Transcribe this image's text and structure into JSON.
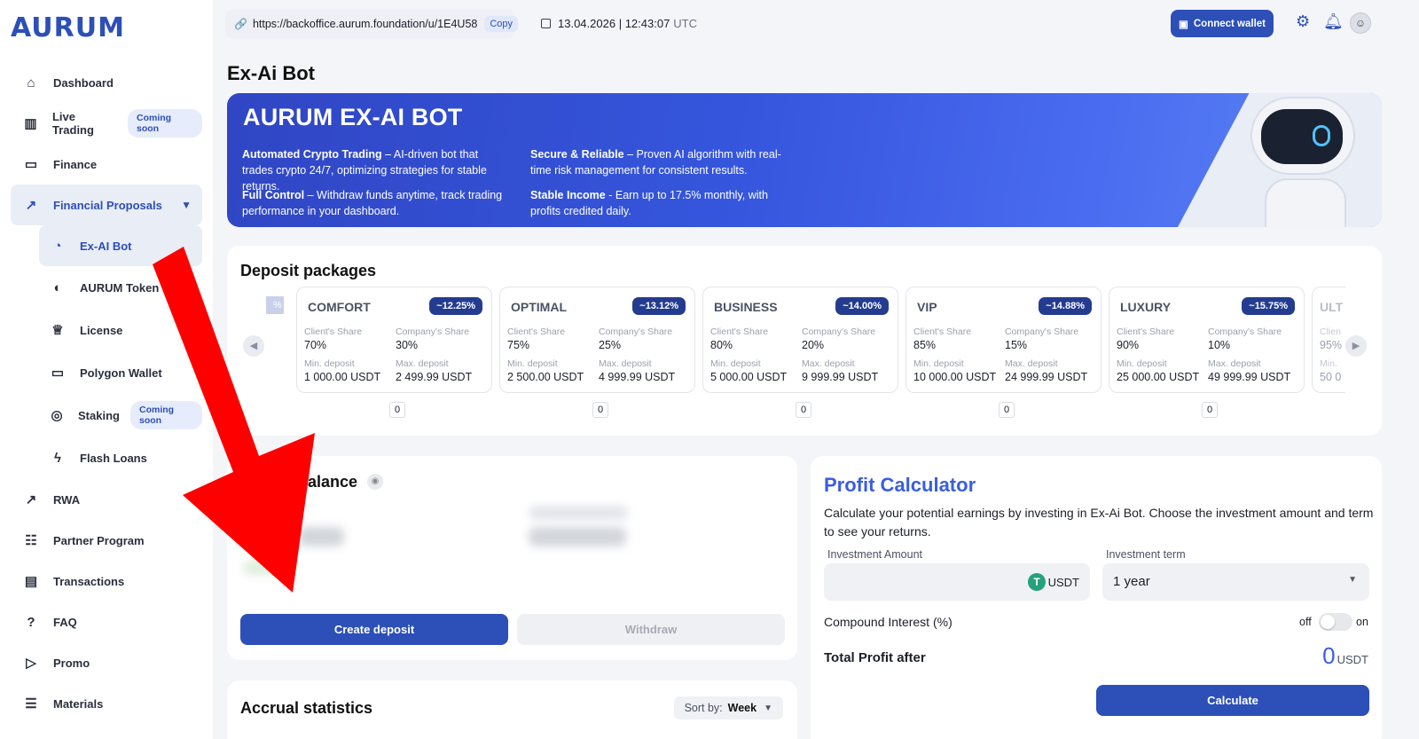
{
  "app": {
    "logo": "AURUM"
  },
  "topbar": {
    "url": "https://backoffice.aurum.foundation/u/1E4U58",
    "copy_label": "Copy",
    "date": "13.04.2026",
    "time": "| 12:43:07",
    "timezone": "UTC",
    "connect_wallet_label": "Connect wallet"
  },
  "sidebar": {
    "items": [
      {
        "label": "Dashboard",
        "icon": "home-icon"
      },
      {
        "label": "Live Trading",
        "icon": "bar-chart-icon",
        "badge": "Coming soon"
      },
      {
        "label": "Finance",
        "icon": "wallet-icon"
      },
      {
        "label": "Financial Proposals",
        "icon": "trend-icon",
        "expanded": true
      },
      {
        "label": "Ex-AI Bot",
        "icon": "pie-icon",
        "active": true
      },
      {
        "label": "AURUM Token",
        "icon": "token-icon"
      },
      {
        "label": "License",
        "icon": "crown-icon"
      },
      {
        "label": "Polygon Wallet",
        "icon": "wallet-icon"
      },
      {
        "label": "Staking",
        "icon": "staking-icon",
        "badge": "Coming soon"
      },
      {
        "label": "Flash Loans",
        "icon": "lightning-icon"
      },
      {
        "label": "RWA",
        "icon": "trend-up-icon"
      },
      {
        "label": "Partner Program",
        "icon": "users-icon"
      },
      {
        "label": "Transactions",
        "icon": "document-icon"
      },
      {
        "label": "FAQ",
        "icon": "question-icon"
      },
      {
        "label": "Promo",
        "icon": "promo-icon"
      },
      {
        "label": "Materials",
        "icon": "materials-icon"
      }
    ]
  },
  "page": {
    "title": "Ex-Ai Bot"
  },
  "banner": {
    "title": "AURUM EX-AI BOT",
    "features": [
      {
        "title": "Automated Crypto Trading",
        "text": " – AI-driven bot that trades crypto 24/7, optimizing strategies for stable returns."
      },
      {
        "title": "Full Control",
        "text": " – Withdraw funds anytime, track trading performance in your dashboard."
      },
      {
        "title": "Secure & Reliable",
        "text": " – Proven AI algorithm with real-time risk management for consistent results."
      },
      {
        "title": "Stable Income",
        "text": " - Earn up to 17.5% monthly, with profits credited daily."
      }
    ]
  },
  "deposit_packages": {
    "title": "Deposit packages",
    "labels": {
      "client_share": "Client's Share",
      "company_share": "Company's Share",
      "min_deposit": "Min. deposit",
      "max_deposit": "Max. deposit"
    },
    "packages": [
      {
        "name": "COMFORT",
        "pct": "~12.25%",
        "client": "70%",
        "company": "30%",
        "min": "1 000.00 USDT",
        "max": "2 499.99 USDT",
        "qty": "0"
      },
      {
        "name": "OPTIMAL",
        "pct": "~13.12%",
        "client": "75%",
        "company": "25%",
        "min": "2 500.00 USDT",
        "max": "4 999.99 USDT",
        "qty": "0"
      },
      {
        "name": "BUSINESS",
        "pct": "~14.00%",
        "client": "80%",
        "company": "20%",
        "min": "5 000.00 USDT",
        "max": "9 999.99 USDT",
        "qty": "0"
      },
      {
        "name": "VIP",
        "pct": "~14.88%",
        "client": "85%",
        "company": "15%",
        "min": "10 000.00 USDT",
        "max": "24 999.99 USDT",
        "qty": "0"
      },
      {
        "name": "LUXURY",
        "pct": "~15.75%",
        "client": "90%",
        "company": "10%",
        "min": "25 000.00 USDT",
        "max": "49 999.99 USDT",
        "qty": "0"
      }
    ],
    "partial_next": {
      "name": "ULT",
      "client_label": "Clien",
      "client": "95%",
      "min_label": "Min.",
      "min": "50 0"
    },
    "partial_prev_pct": "%"
  },
  "balance": {
    "title": "balance",
    "create_label": "Create deposit",
    "withdraw_label": "Withdraw"
  },
  "accrual": {
    "title": "Accrual statistics",
    "sort_label": "Sort by:",
    "sort_value": "Week"
  },
  "calculator": {
    "title": "Profit Calculator",
    "description": "Calculate your potential earnings by investing in Ex-Ai Bot. Choose the investment amount and term to see your returns.",
    "amount_label": "Investment Amount",
    "amount_placeholder": "",
    "currency": "USDT",
    "term_label": "Investment term",
    "term_value": "1 year",
    "compound_label": "Compound Interest (%)",
    "compound_off": "off",
    "compound_on": "on",
    "compound_enabled": false,
    "total_label": "Total Profit after",
    "total_value": "0",
    "total_unit": "USDT",
    "calculate_label": "Calculate"
  },
  "colors": {
    "accent": "#2c4fb8",
    "title_blue": "#3a5ee0",
    "badge_dark": "#243c90",
    "arrow_red": "#ff0000"
  }
}
